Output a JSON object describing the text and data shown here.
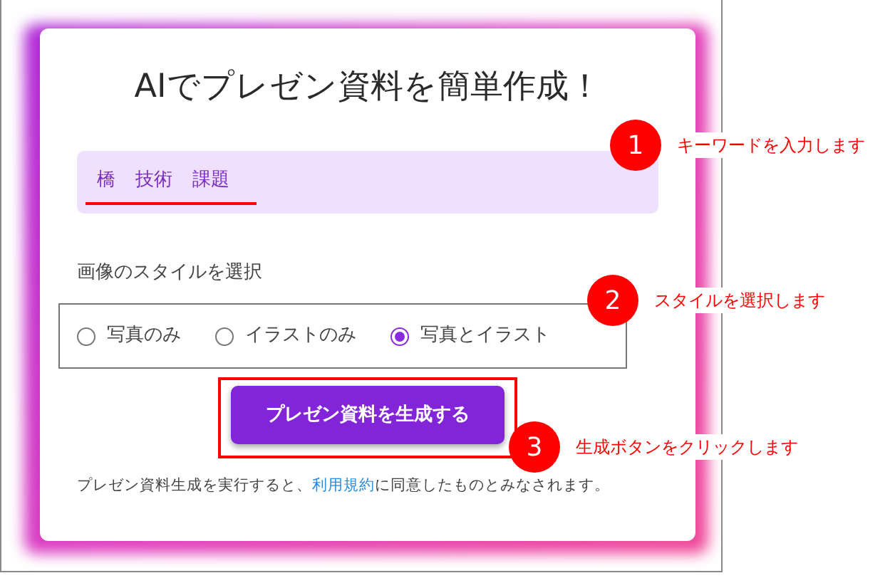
{
  "title": "AIでプレゼン資料を簡単作成！",
  "keyword_box": {
    "keywords": [
      "橋",
      "技術",
      "課題"
    ]
  },
  "style_label": "画像のスタイルを選択",
  "style_options": [
    {
      "label": "写真のみ",
      "selected": false
    },
    {
      "label": "イラストのみ",
      "selected": false
    },
    {
      "label": "写真とイラスト",
      "selected": true
    }
  ],
  "generate_button": "プレゼン資料を生成する",
  "note": {
    "before": "プレゼン資料生成を実行すると、",
    "link": "利用規約",
    "after": "に同意したものとみなされます。"
  },
  "annotations": [
    {
      "number": "1",
      "text": "キーワードを入力します"
    },
    {
      "number": "2",
      "text": "スタイルを選択します"
    },
    {
      "number": "3",
      "text": "生成ボタンをクリックします"
    }
  ]
}
